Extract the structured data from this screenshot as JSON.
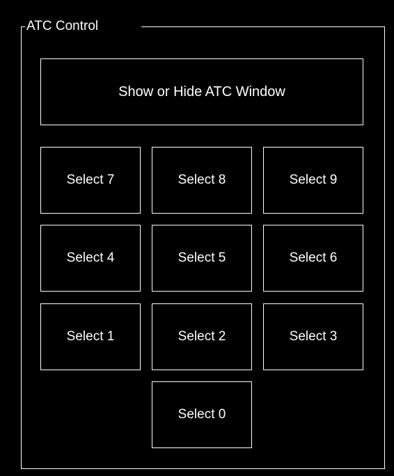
{
  "panel": {
    "title": "ATC Control",
    "colors": {
      "background": "#000000",
      "border": "#ffffff",
      "text": "#ffffff"
    }
  },
  "buttons": {
    "toggle_window": "Show or Hide ATC Window",
    "select_7": "Select 7",
    "select_8": "Select 8",
    "select_9": "Select 9",
    "select_4": "Select 4",
    "select_5": "Select 5",
    "select_6": "Select 6",
    "select_1": "Select 1",
    "select_2": "Select 2",
    "select_3": "Select 3",
    "select_0": "Select 0"
  }
}
